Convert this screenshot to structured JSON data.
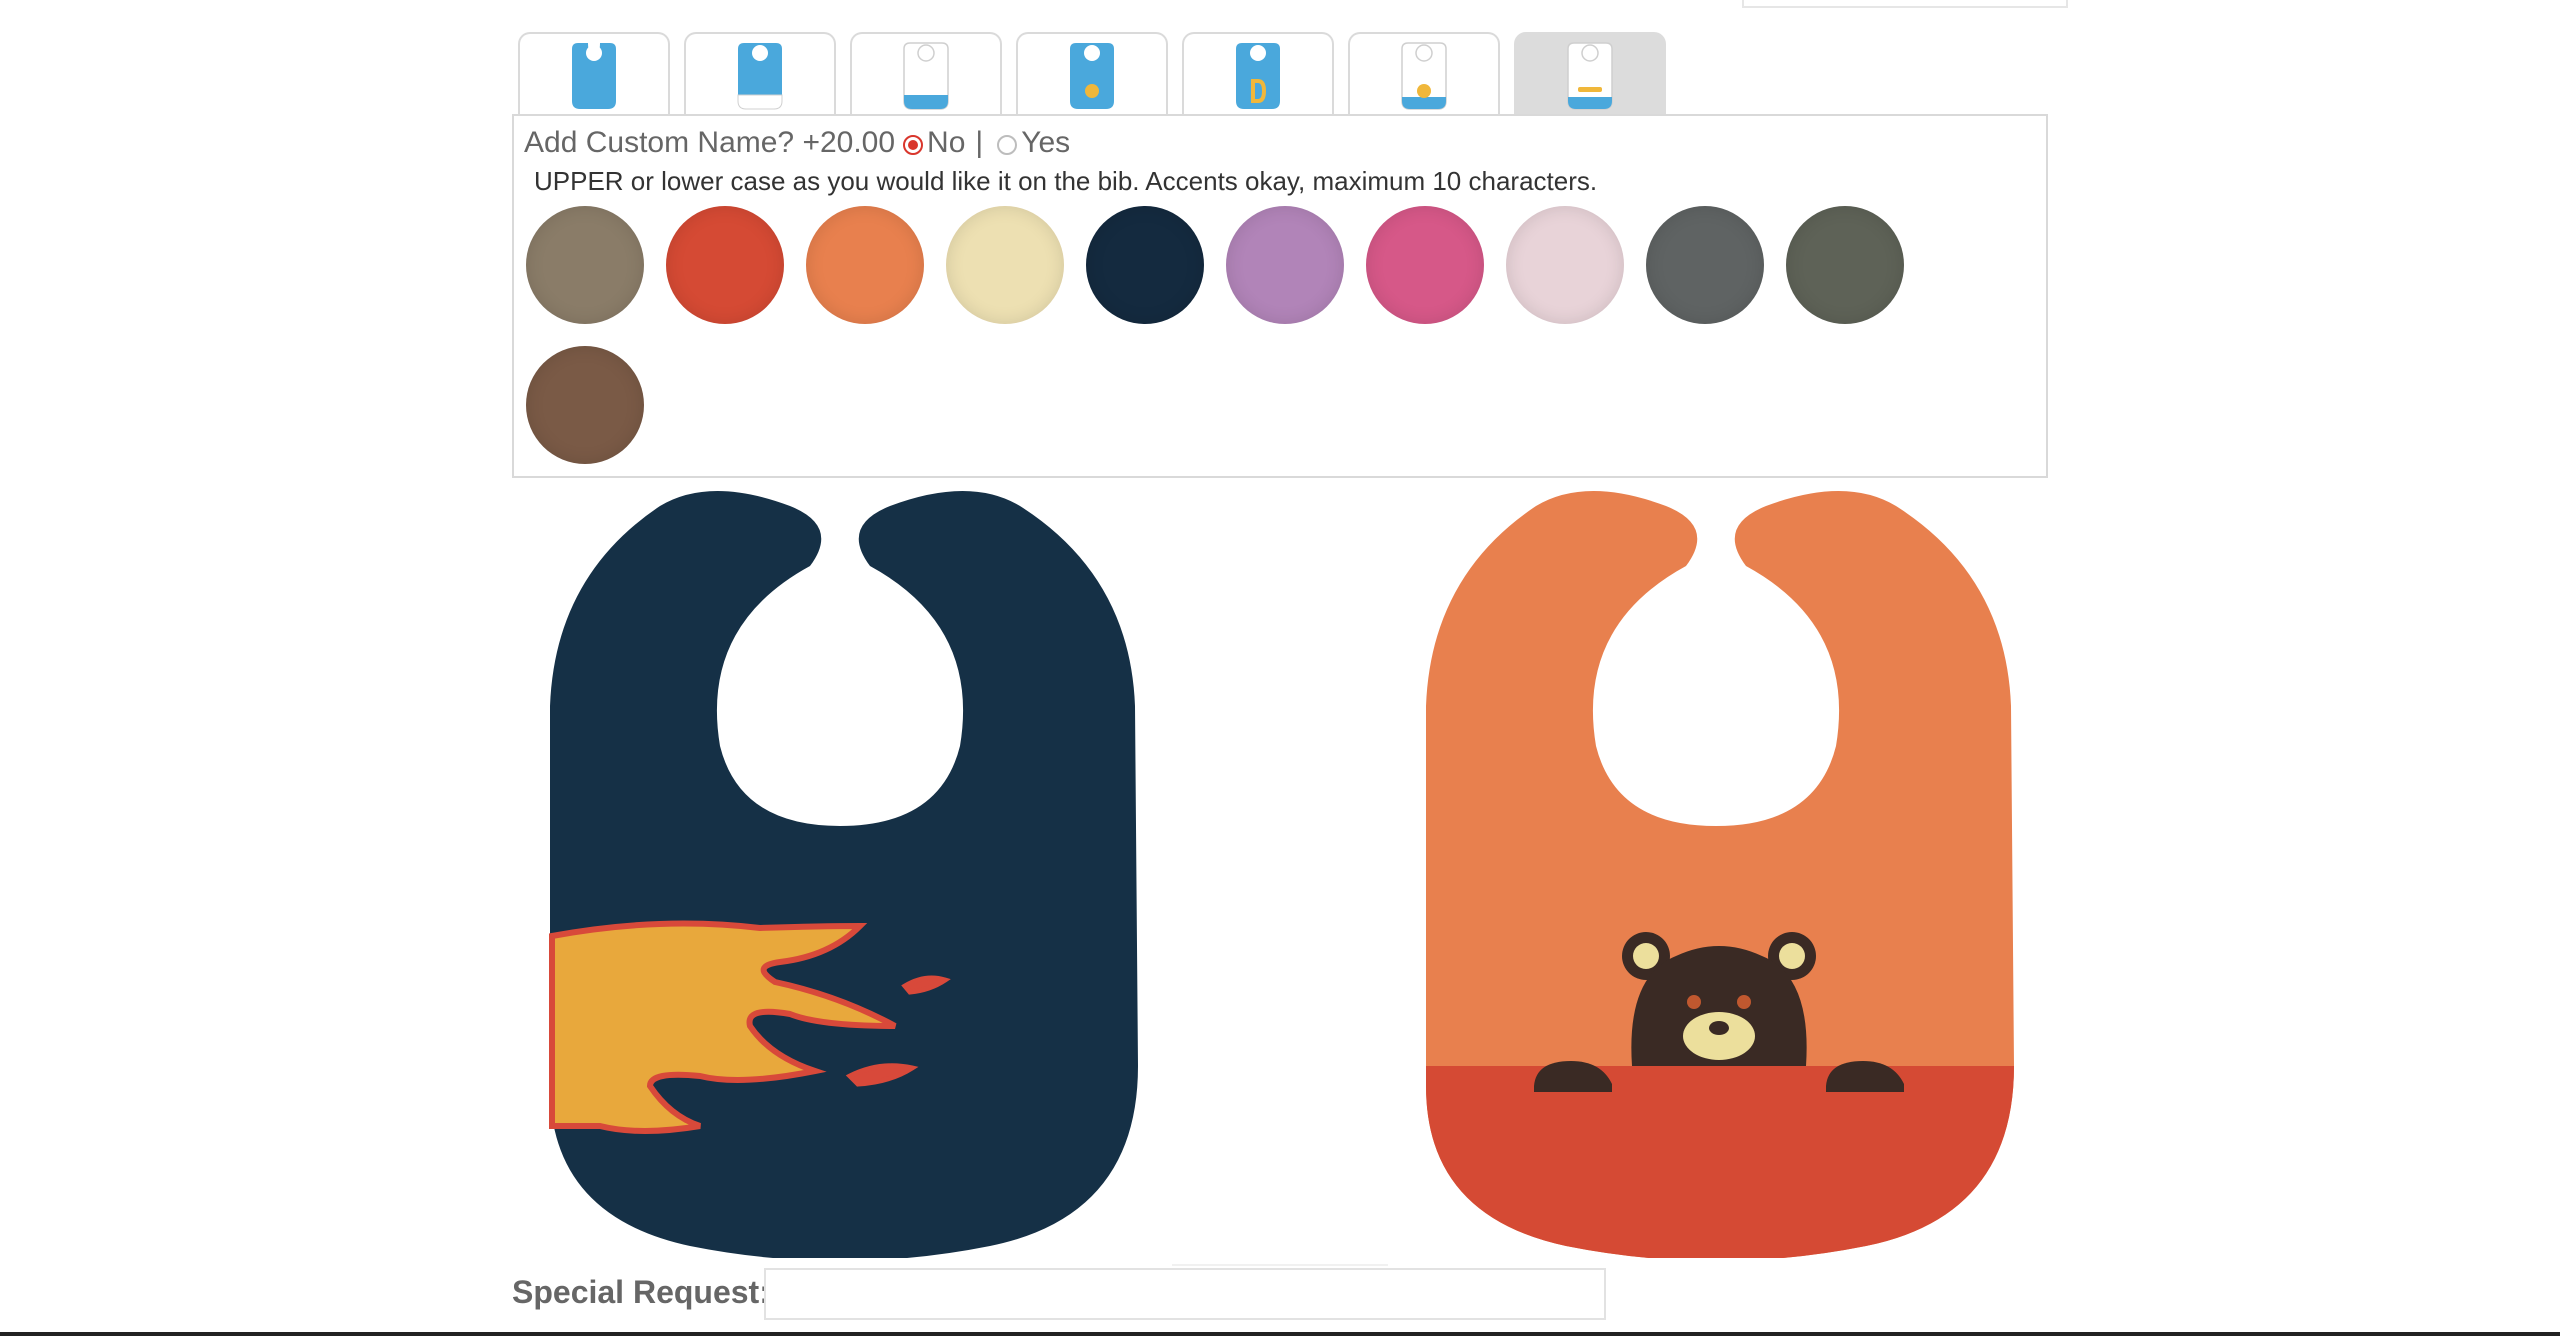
{
  "bib_style_tabs": [
    {
      "name": "solid-blue-bib"
    },
    {
      "name": "blue-bib-white-bottom"
    },
    {
      "name": "white-bib-blue-bottom"
    },
    {
      "name": "blue-bib-yellow-dot"
    },
    {
      "name": "blue-bib-letter-d"
    },
    {
      "name": "white-bib-yellow-dot-blue-bottom"
    },
    {
      "name": "white-bib-yellow-line-blue-bottom",
      "active": true
    }
  ],
  "custom_name": {
    "question": "Add Custom Name? +20.00",
    "option_no": "No",
    "separator": "|",
    "option_yes": "Yes",
    "selected": "No",
    "hint": "UPPER or lower case as you would like it on the bib. Accents okay, maximum 10 characters."
  },
  "colors": {
    "swatches": [
      "#8a7c68",
      "#d54a34",
      "#e8804e",
      "#ede0b2",
      "#142a3f",
      "#b184b8",
      "#d65888",
      "#e8d3d8",
      "#5f6363",
      "#5e6257",
      "#7a5a46"
    ],
    "accent_blue": "#4aa8dc",
    "accent_yellow": "#f0b73a",
    "radio_selected": "#d9362c"
  },
  "previews": {
    "left": {
      "bib_color": "#153046",
      "applique": "flame",
      "applique_color": "#e8a83c",
      "trim_color": "#d8493a"
    },
    "right": {
      "bib_color": "#e8804e",
      "bottom_color": "#d54a34",
      "applique": "bear",
      "applique_color": "#3a2a24"
    }
  },
  "special_request": {
    "label": "Special Request:",
    "value": ""
  }
}
